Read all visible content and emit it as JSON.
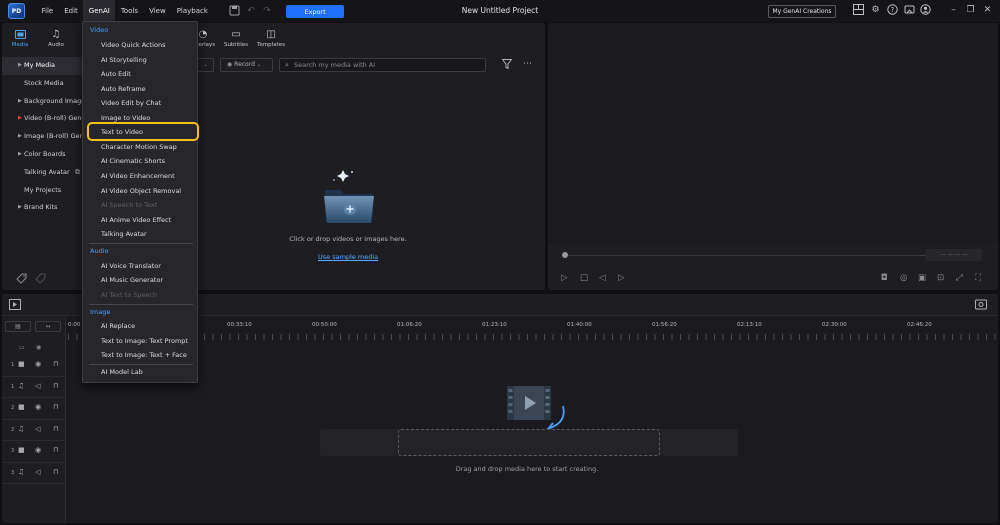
{
  "titlebar": {
    "menu": [
      "File",
      "Edit",
      "GenAI",
      "Tools",
      "View",
      "Playback"
    ],
    "active_menu": "GenAI",
    "export_label": "Export",
    "project_title": "New Untitled Project",
    "genai_creations_label": "My GenAI Creations",
    "app_logo_text": "PD"
  },
  "media_panel": {
    "tabs": [
      {
        "label": "Media",
        "icon": "media-folder-icon"
      },
      {
        "label": "Audio",
        "icon": "music-note-icon"
      }
    ],
    "hidden_tabs": [
      {
        "label": "Overlays",
        "icon": "overlays-icon"
      },
      {
        "label": "Subtitles",
        "icon": "subtitles-icon"
      },
      {
        "label": "Templates",
        "icon": "templates-icon"
      }
    ],
    "sidebar": [
      {
        "label": "My Media",
        "arrow": true,
        "active": true
      },
      {
        "label": "Stock Media",
        "arrow": false
      },
      {
        "label": "Background Images",
        "arrow": true
      },
      {
        "label": "Video (B-roll) Generator",
        "arrow": true
      },
      {
        "label": "Image (B-roll) Generator",
        "arrow": true
      },
      {
        "label": "Color Boards",
        "arrow": true
      },
      {
        "label": "Talking Avatar",
        "arrow": false
      },
      {
        "label": "My Projects",
        "arrow": false
      },
      {
        "label": "Brand Kits",
        "arrow": true
      }
    ],
    "record_label": "Record",
    "search_placeholder": "Search my media with AI",
    "drop_text": "Click or drop videos or images here.",
    "sample_link": "Use sample media"
  },
  "timeline": {
    "ruler": [
      "0:00",
      "00:33:10",
      "00:50:00",
      "01:06:20",
      "01:23:10",
      "01:40:00",
      "01:56:20",
      "02:13:10",
      "02:30:00",
      "02:46:20"
    ],
    "tracks": [
      {
        "num": "1",
        "type": "video"
      },
      {
        "num": "1",
        "type": "audio"
      },
      {
        "num": "2",
        "type": "video"
      },
      {
        "num": "2",
        "type": "audio"
      },
      {
        "num": "3",
        "type": "video"
      },
      {
        "num": "3",
        "type": "audio"
      }
    ],
    "drop_text": "Drag and drop media here to start creating."
  },
  "genai_menu": {
    "sections": [
      {
        "title": "Video",
        "items": [
          {
            "label": "Video Quick Actions",
            "enabled": true
          },
          {
            "label": "AI Storytelling",
            "enabled": true
          },
          {
            "label": "Auto Edit",
            "enabled": true
          },
          {
            "label": "Auto Reframe",
            "enabled": true
          },
          {
            "label": "Video Edit by Chat",
            "enabled": true
          },
          {
            "label": "Image to Video",
            "enabled": true
          },
          {
            "label": "Text to Video",
            "enabled": true,
            "highlighted": true
          },
          {
            "label": "Character Motion Swap",
            "enabled": true
          },
          {
            "label": "AI Cinematic Shorts",
            "enabled": true
          },
          {
            "label": "AI Video Enhancement",
            "enabled": true
          },
          {
            "label": "AI Video Object Removal",
            "enabled": true
          },
          {
            "label": "AI Speech to Text",
            "enabled": false
          },
          {
            "label": "AI Anime Video Effect",
            "enabled": true
          },
          {
            "label": "Talking Avatar",
            "enabled": true
          }
        ]
      },
      {
        "title": "Audio",
        "items": [
          {
            "label": "AI Voice Translator",
            "enabled": true
          },
          {
            "label": "AI Music Generator",
            "enabled": true
          },
          {
            "label": "AI Text to Speech",
            "enabled": false
          }
        ]
      },
      {
        "title": "Image",
        "items": [
          {
            "label": "AI Replace",
            "enabled": true
          },
          {
            "label": "Text to Image: Text Prompt",
            "enabled": true
          },
          {
            "label": "Text to Image: Text + Face",
            "enabled": true
          }
        ]
      }
    ],
    "footer_item": "AI Model Lab"
  },
  "colors": {
    "accent": "#1f6fff",
    "link": "#5aaaff",
    "section_title": "#4aa0ff",
    "highlight": "#f2c21a"
  }
}
